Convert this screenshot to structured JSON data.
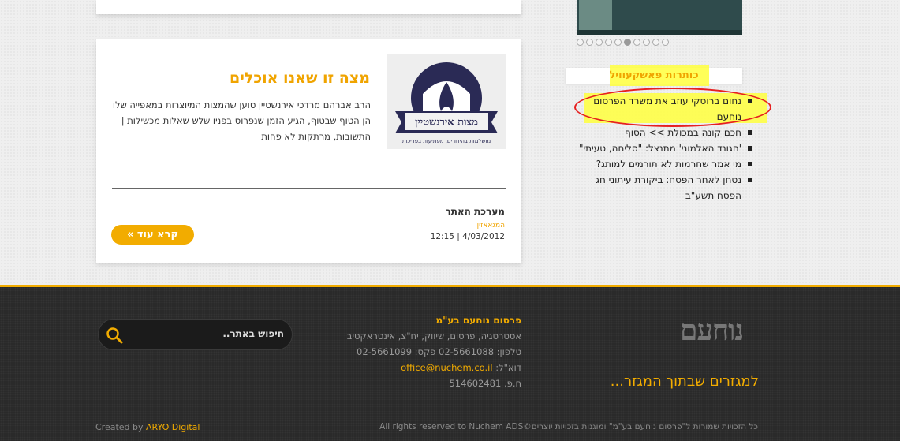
{
  "article": {
    "title": "מצה זו שאנו אוכלים",
    "excerpt": "הרב אברהם מרדכי אירנשטיין טוען שהמצות המיוצרות במאפייה שלו הן הטוף שבטוף, הגיע הזמן שנפרוס בפניו שלש שאלות מכשילות | התשובות, מרתקות לא פחות",
    "logo_text": "מצות אירנשטיין",
    "logo_subtext": "מושלמות בהידורים, מפתיעות בפריכות",
    "author": "מערכת האתר",
    "category": "המגאאזין",
    "date": "12:15 | 4/03/2012",
    "read_more": "קרא עוד »"
  },
  "sidebar": {
    "slider_dots": 10,
    "active_dot": 5,
    "title": "כותרות פאשקעוויל",
    "headlines": [
      "נחום ברוסקי עוזב את משרד הפרסום נוחעם",
      "חכם קונה במכולת >> הסוף",
      "'הגונד האלמוני' מתנצל: \"סליחה, טעיתי\"",
      "מי אמר שחרמות לא תורמים למותג?",
      "נטחן לאחר הפסח: ביקורת עיתוני חג הפסח תשע\"ב"
    ]
  },
  "footer": {
    "logo": "נוחעם",
    "slogan": "למגזרים שבתוך המגזר...",
    "company_name": "פרסום נוחעם בע\"מ",
    "services": "אסטרטגיה, פרסום, שיווק, יח\"צ, אינטראקטיב",
    "phone_line": "טלפון: 02-5661088 פקס: 02-5661099",
    "email_label": "דוא\"ל:",
    "email": "office@nuchem.co.il",
    "company_id": "ח.פ. 514602481",
    "search_placeholder": "חיפוש באתר..",
    "copyright": "כל הזכויות שמורות ל\"פרסום נוחעם בע\"מ\" ומוגנות בזכויות יוצרים©All rights reserved to Nuchem ADS",
    "credit_prefix": "Created by",
    "credit_brand": "ARYO Digital"
  },
  "colors": {
    "accent": "#f2ac00",
    "highlight": "#ffff3c",
    "annotation": "#e62020",
    "footer_bg": "#2a2a2a"
  }
}
